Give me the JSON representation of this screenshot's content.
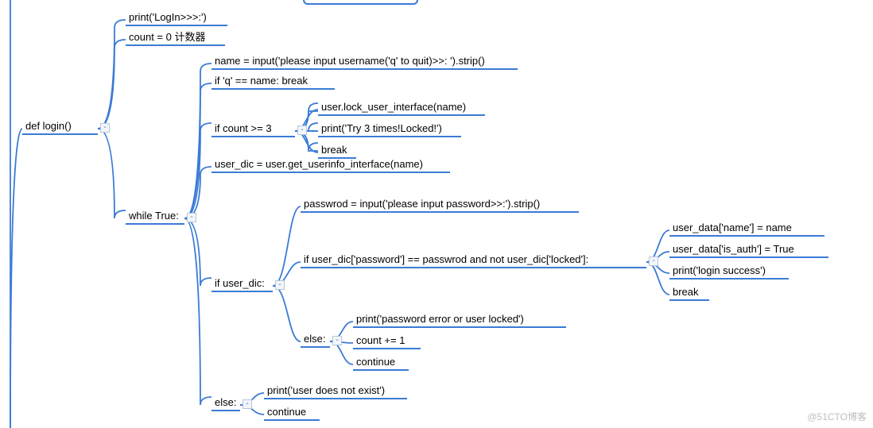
{
  "watermark": "@51CTO博客",
  "root": {
    "label": "def login()"
  },
  "level1": [
    {
      "label": "print('LogIn>>>:')"
    },
    {
      "label": "count = 0 计数器"
    },
    {
      "label": "while True:"
    }
  ],
  "whileTrue": [
    {
      "label": "name = input('please input username('q' to quit)>>:  ').strip()"
    },
    {
      "label": "if 'q' == name: break"
    },
    {
      "label": "if count >= 3"
    },
    {
      "label": "user_dic = user.get_userinfo_interface(name)"
    },
    {
      "label": "if user_dic:"
    },
    {
      "label": "else:"
    }
  ],
  "countGE3": [
    {
      "label": "user.lock_user_interface(name)"
    },
    {
      "label": "print('Try 3 times!Locked!')"
    },
    {
      "label": "break"
    }
  ],
  "ifUserDic": [
    {
      "label": "passwrod = input('please input password>>:').strip()"
    },
    {
      "label": "if user_dic['password'] == passwrod and not user_dic['locked']:"
    },
    {
      "label": "else:"
    }
  ],
  "pwOk": [
    {
      "label": "user_data['name'] = name"
    },
    {
      "label": "user_data['is_auth'] = True"
    },
    {
      "label": "print('login success')"
    },
    {
      "label": "break"
    }
  ],
  "pwElse": [
    {
      "label": "print('password error or user locked')"
    },
    {
      "label": "count += 1"
    },
    {
      "label": "continue"
    }
  ],
  "outerElse": [
    {
      "label": "print('user does not exist')"
    },
    {
      "label": "continue"
    }
  ]
}
